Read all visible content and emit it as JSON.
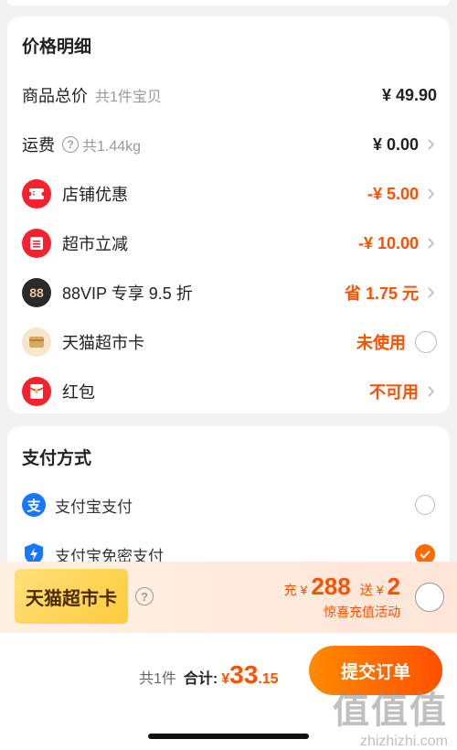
{
  "price_details": {
    "title": "价格明细",
    "rows": [
      {
        "label": "商品总价",
        "sub": "共1件宝贝",
        "value": "¥ 49.90"
      },
      {
        "label": "运费",
        "sub": "共1.44kg",
        "value": "¥ 0.00"
      },
      {
        "label": "店铺优惠",
        "value": "-¥ 5.00"
      },
      {
        "label": "超市立减",
        "value": "-¥ 10.00"
      },
      {
        "label": "88VIP 专享 9.5 折",
        "icon_text": "88",
        "value": "省 1.75 元"
      },
      {
        "label": "天猫超市卡",
        "value": "未使用"
      },
      {
        "label": "红包",
        "value": "不可用"
      }
    ]
  },
  "payment": {
    "title": "支付方式",
    "options": [
      {
        "label": "支付宝支付",
        "selected": false,
        "icon": "alipay-icon"
      },
      {
        "label": "支付宝免密支付",
        "selected": true,
        "icon": "lightning-shield-icon"
      }
    ]
  },
  "promo": {
    "card_label": "天猫超市卡",
    "recharge_prefix": "充",
    "recharge_currency": "¥",
    "recharge_amount": "288",
    "gift_prefix": "送",
    "gift_currency": "¥",
    "gift_amount": "2",
    "subtitle": "惊喜充值活动"
  },
  "footer": {
    "count": "共1件",
    "total_label": "合计:",
    "currency": "¥",
    "total_int": "33",
    "total_dec": ".15",
    "submit_label": "提交订单"
  },
  "watermark": {
    "big": "值值值",
    "small": "zhizhizhi.com"
  },
  "colors": {
    "accent": "#ff5000",
    "red_icon": "#f5222d",
    "dark_icon": "#2a2a2a"
  }
}
